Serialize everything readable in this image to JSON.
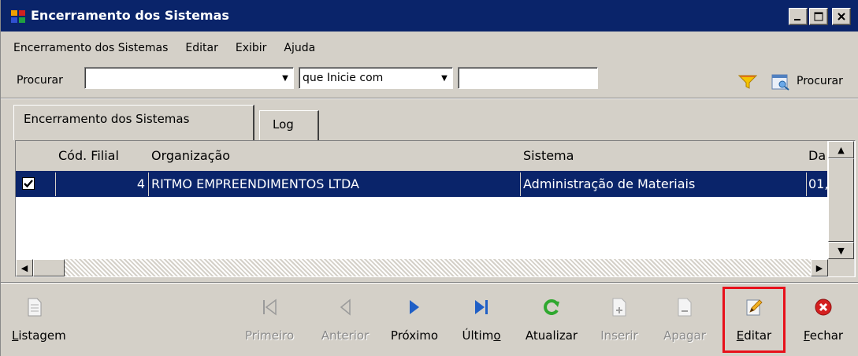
{
  "window": {
    "title": "Encerramento dos Sistemas",
    "controls": [
      "_",
      "□",
      "x"
    ]
  },
  "menu": {
    "items": [
      "Encerramento dos Sistemas",
      "Editar",
      "Exibir",
      "Ajuda"
    ]
  },
  "search": {
    "label": "Procurar",
    "field_value": "",
    "condition_value": "que Inicie com",
    "text_value": "",
    "button_label": "Procurar"
  },
  "tabs": [
    {
      "label": "Encerramento dos Sistemas",
      "active": true
    },
    {
      "label": "Log",
      "active": false
    }
  ],
  "grid": {
    "columns": [
      "Cód. Filial",
      "Organização",
      "Sistema",
      "Da"
    ],
    "rows": [
      {
        "checked": true,
        "cod_filial": "4",
        "organizacao": "RITMO EMPREENDIMENTOS LTDA",
        "sistema": "Administração de Materiais",
        "data": "01,"
      }
    ]
  },
  "toolbar": {
    "listagem": "Listagem",
    "primeiro": "Primeiro",
    "anterior": "Anterior",
    "proximo": "Próximo",
    "ultimo": "Último",
    "atualizar": "Atualizar",
    "inserir": "Inserir",
    "apagar": "Apagar",
    "editar": "Editar",
    "fechar": "Fechar"
  },
  "colors": {
    "titlebar": "#0a246a",
    "selected_row": "#0a246a",
    "highlight_box": "#e8101a",
    "nav_blue": "#1f5fc6",
    "refresh_green": "#2fa82f",
    "close_red": "#d42020"
  }
}
